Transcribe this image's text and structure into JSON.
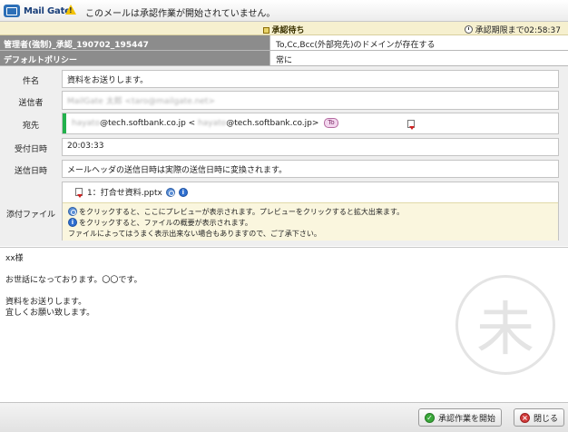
{
  "app": {
    "name": "Mail Gate"
  },
  "top": {
    "message": "このメールは承認作業が開始されていません。"
  },
  "status": {
    "title": "承認待ち",
    "deadline": "承認期限まで02:58:37"
  },
  "policies": [
    {
      "name": "管理者(強制)_承認_190702_195447",
      "condition": "To,Cc,Bcc(外部宛先)のドメインが存在する"
    },
    {
      "name": "デフォルトポリシー",
      "condition": "常に"
    }
  ],
  "fields": {
    "subject": {
      "label": "件名",
      "value": "資料をお送りします。"
    },
    "sender": {
      "label": "送信者",
      "value": "MailGate 太郎 <taro@mailgate.net>"
    },
    "to": {
      "label": "宛先",
      "name_local": "hayato",
      "name_domain": "@tech.softbank.co.jp",
      "addr_open": " < ",
      "addr_local": "hayato",
      "addr_domain": "@tech.softbank.co.jp",
      "addr_close": ">",
      "badge": "To"
    },
    "received": {
      "label": "受付日時",
      "value": "20:03:33"
    },
    "sent": {
      "label": "送信日時",
      "value": "メールヘッダの送信日時は実際の送信日時に変換されます。"
    },
    "attachments": {
      "label": "添付ファイル",
      "file": "1：打合せ資料.pptx",
      "help": [
        "をクリックすると、ここにプレビューが表示されます。プレビューをクリックすると拡大出来ます。",
        "をクリックすると、ファイルの概要が表示されます。",
        "ファイルによってはうまく表示出来ない場合もありますので、ご了承下さい。"
      ]
    }
  },
  "body": {
    "lines": [
      "xx様",
      "",
      "お世話になっております。〇〇です。",
      "",
      "資料をお送りします。",
      "宜しくお願い致します。"
    ],
    "stamp": "未"
  },
  "buttons": {
    "start": "承認作業を開始",
    "close": "閉じる"
  },
  "colors": {
    "status_bg": "#f6f0cf",
    "policy_label_bg": "#8c8c8c",
    "to_bar": "#22b14c",
    "help_bg": "#faf6de"
  }
}
